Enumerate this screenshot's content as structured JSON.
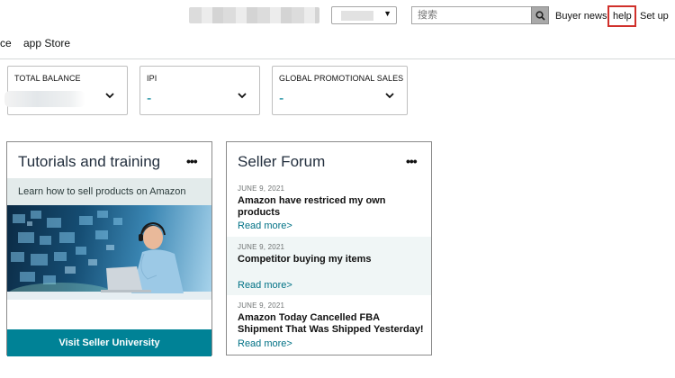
{
  "header": {
    "search_placeholder": "搜索",
    "links": {
      "buyer_news": "Buyer news",
      "help": "help",
      "setup": "Set up"
    }
  },
  "nav": {
    "items": [
      "ce",
      "app Store"
    ]
  },
  "metrics": [
    {
      "label": "TOTAL BALANCE",
      "value": ""
    },
    {
      "label": "IPI",
      "value": "-"
    },
    {
      "label": "GLOBAL PROMOTIONAL SALES",
      "value": "-"
    }
  ],
  "tutorials": {
    "title": "Tutorials and training",
    "more": "•••",
    "subtitle": "Learn how to sell products on Amazon",
    "button": "Visit Seller University"
  },
  "forum": {
    "title": "Seller Forum",
    "more": "•••",
    "posts": [
      {
        "date": "JUNE 9, 2021",
        "headline": "Amazon have restriced my own products",
        "more": "Read more>"
      },
      {
        "date": "JUNE 9, 2021",
        "headline": "Competitor buying my items",
        "more": "Read more>"
      },
      {
        "date": "JUNE 9, 2021",
        "headline": "Amazon Today Cancelled FBA Shipment That Was Shipped Yesterday!",
        "more": "Read more>"
      }
    ]
  },
  "colors": {
    "teal": "#008296",
    "link": "#007185",
    "highlight_box": "#d0302b"
  },
  "icons": {
    "search": "magnifier-icon",
    "dropdown": "chevron-down-icon",
    "more": "ellipsis-icon"
  }
}
